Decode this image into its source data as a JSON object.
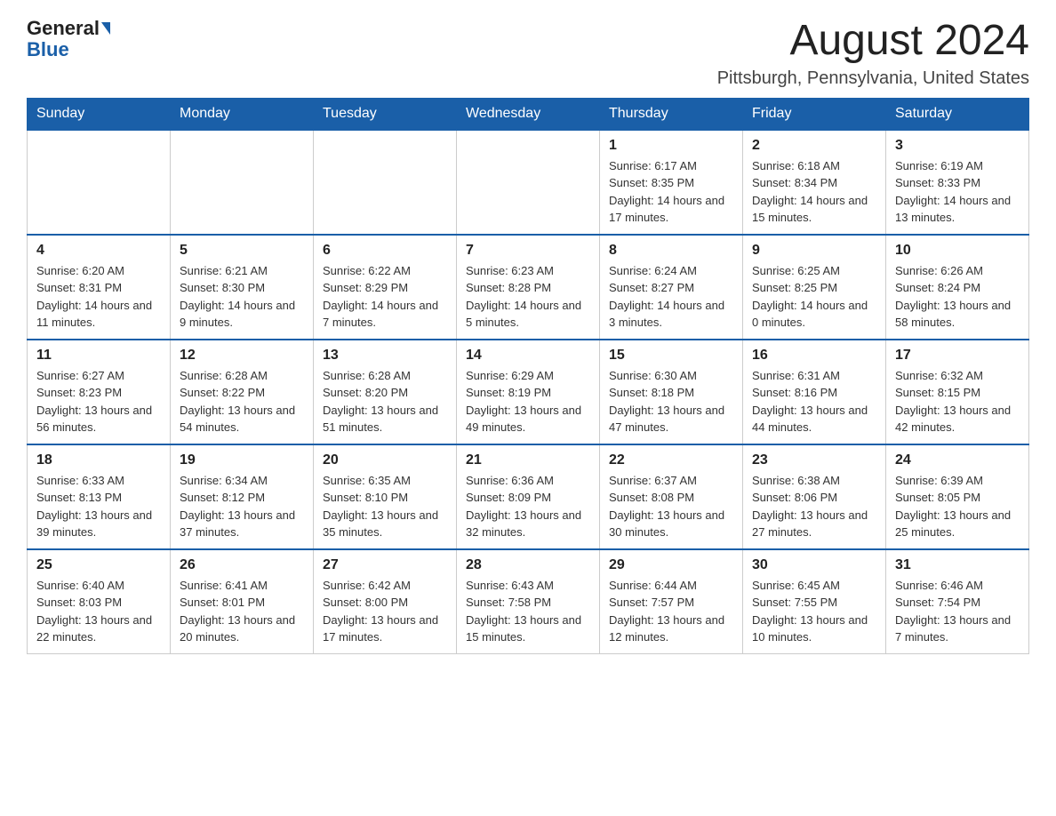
{
  "header": {
    "logo_general": "General",
    "logo_blue": "Blue",
    "month_title": "August 2024",
    "location": "Pittsburgh, Pennsylvania, United States"
  },
  "days_of_week": [
    "Sunday",
    "Monday",
    "Tuesday",
    "Wednesday",
    "Thursday",
    "Friday",
    "Saturday"
  ],
  "weeks": [
    [
      {
        "day": "",
        "info": ""
      },
      {
        "day": "",
        "info": ""
      },
      {
        "day": "",
        "info": ""
      },
      {
        "day": "",
        "info": ""
      },
      {
        "day": "1",
        "info": "Sunrise: 6:17 AM\nSunset: 8:35 PM\nDaylight: 14 hours and 17 minutes."
      },
      {
        "day": "2",
        "info": "Sunrise: 6:18 AM\nSunset: 8:34 PM\nDaylight: 14 hours and 15 minutes."
      },
      {
        "day": "3",
        "info": "Sunrise: 6:19 AM\nSunset: 8:33 PM\nDaylight: 14 hours and 13 minutes."
      }
    ],
    [
      {
        "day": "4",
        "info": "Sunrise: 6:20 AM\nSunset: 8:31 PM\nDaylight: 14 hours and 11 minutes."
      },
      {
        "day": "5",
        "info": "Sunrise: 6:21 AM\nSunset: 8:30 PM\nDaylight: 14 hours and 9 minutes."
      },
      {
        "day": "6",
        "info": "Sunrise: 6:22 AM\nSunset: 8:29 PM\nDaylight: 14 hours and 7 minutes."
      },
      {
        "day": "7",
        "info": "Sunrise: 6:23 AM\nSunset: 8:28 PM\nDaylight: 14 hours and 5 minutes."
      },
      {
        "day": "8",
        "info": "Sunrise: 6:24 AM\nSunset: 8:27 PM\nDaylight: 14 hours and 3 minutes."
      },
      {
        "day": "9",
        "info": "Sunrise: 6:25 AM\nSunset: 8:25 PM\nDaylight: 14 hours and 0 minutes."
      },
      {
        "day": "10",
        "info": "Sunrise: 6:26 AM\nSunset: 8:24 PM\nDaylight: 13 hours and 58 minutes."
      }
    ],
    [
      {
        "day": "11",
        "info": "Sunrise: 6:27 AM\nSunset: 8:23 PM\nDaylight: 13 hours and 56 minutes."
      },
      {
        "day": "12",
        "info": "Sunrise: 6:28 AM\nSunset: 8:22 PM\nDaylight: 13 hours and 54 minutes."
      },
      {
        "day": "13",
        "info": "Sunrise: 6:28 AM\nSunset: 8:20 PM\nDaylight: 13 hours and 51 minutes."
      },
      {
        "day": "14",
        "info": "Sunrise: 6:29 AM\nSunset: 8:19 PM\nDaylight: 13 hours and 49 minutes."
      },
      {
        "day": "15",
        "info": "Sunrise: 6:30 AM\nSunset: 8:18 PM\nDaylight: 13 hours and 47 minutes."
      },
      {
        "day": "16",
        "info": "Sunrise: 6:31 AM\nSunset: 8:16 PM\nDaylight: 13 hours and 44 minutes."
      },
      {
        "day": "17",
        "info": "Sunrise: 6:32 AM\nSunset: 8:15 PM\nDaylight: 13 hours and 42 minutes."
      }
    ],
    [
      {
        "day": "18",
        "info": "Sunrise: 6:33 AM\nSunset: 8:13 PM\nDaylight: 13 hours and 39 minutes."
      },
      {
        "day": "19",
        "info": "Sunrise: 6:34 AM\nSunset: 8:12 PM\nDaylight: 13 hours and 37 minutes."
      },
      {
        "day": "20",
        "info": "Sunrise: 6:35 AM\nSunset: 8:10 PM\nDaylight: 13 hours and 35 minutes."
      },
      {
        "day": "21",
        "info": "Sunrise: 6:36 AM\nSunset: 8:09 PM\nDaylight: 13 hours and 32 minutes."
      },
      {
        "day": "22",
        "info": "Sunrise: 6:37 AM\nSunset: 8:08 PM\nDaylight: 13 hours and 30 minutes."
      },
      {
        "day": "23",
        "info": "Sunrise: 6:38 AM\nSunset: 8:06 PM\nDaylight: 13 hours and 27 minutes."
      },
      {
        "day": "24",
        "info": "Sunrise: 6:39 AM\nSunset: 8:05 PM\nDaylight: 13 hours and 25 minutes."
      }
    ],
    [
      {
        "day": "25",
        "info": "Sunrise: 6:40 AM\nSunset: 8:03 PM\nDaylight: 13 hours and 22 minutes."
      },
      {
        "day": "26",
        "info": "Sunrise: 6:41 AM\nSunset: 8:01 PM\nDaylight: 13 hours and 20 minutes."
      },
      {
        "day": "27",
        "info": "Sunrise: 6:42 AM\nSunset: 8:00 PM\nDaylight: 13 hours and 17 minutes."
      },
      {
        "day": "28",
        "info": "Sunrise: 6:43 AM\nSunset: 7:58 PM\nDaylight: 13 hours and 15 minutes."
      },
      {
        "day": "29",
        "info": "Sunrise: 6:44 AM\nSunset: 7:57 PM\nDaylight: 13 hours and 12 minutes."
      },
      {
        "day": "30",
        "info": "Sunrise: 6:45 AM\nSunset: 7:55 PM\nDaylight: 13 hours and 10 minutes."
      },
      {
        "day": "31",
        "info": "Sunrise: 6:46 AM\nSunset: 7:54 PM\nDaylight: 13 hours and 7 minutes."
      }
    ]
  ]
}
